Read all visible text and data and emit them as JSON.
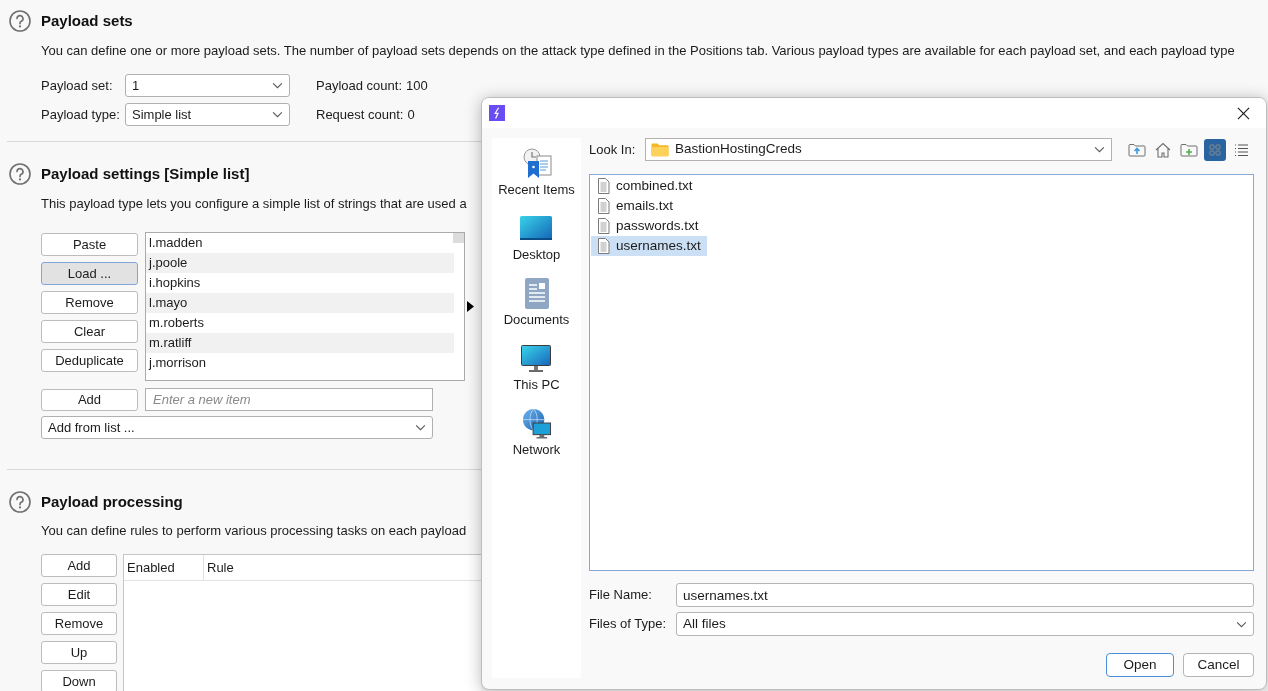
{
  "payload_sets": {
    "title": "Payload sets",
    "description": "You can define one or more payload sets. The number of payload sets depends on the attack type defined in the Positions tab. Various payload types are available for each payload set, and each payload type",
    "fields": [
      {
        "label": "Payload set:",
        "value": "1"
      },
      {
        "label": "Payload type:",
        "value": "Simple list"
      }
    ],
    "counts": [
      {
        "label": "Payload count:",
        "value": "100"
      },
      {
        "label": "Request count:",
        "value": "0"
      }
    ]
  },
  "payload_settings": {
    "title": "Payload settings [Simple list]",
    "description": "This payload type lets you configure a simple list of strings that are used a",
    "buttons": [
      {
        "label": "Paste",
        "focused": false
      },
      {
        "label": "Load ...",
        "focused": true
      },
      {
        "label": "Remove",
        "focused": false
      },
      {
        "label": "Clear",
        "focused": false
      },
      {
        "label": "Deduplicate",
        "focused": false
      }
    ],
    "items": [
      "l.madden",
      "j.poole",
      "i.hopkins",
      "l.mayo",
      "m.roberts",
      "m.ratliff",
      "j.morrison"
    ],
    "add_button": "Add",
    "new_item": {
      "placeholder": "Enter a new item"
    },
    "add_from_list": {
      "value": "Add from list ..."
    }
  },
  "payload_processing": {
    "title": "Payload processing",
    "description": "You can define rules to perform various processing tasks on each payload",
    "buttons": [
      "Add",
      "Edit",
      "Remove",
      "Up",
      "Down"
    ],
    "table": {
      "columns": [
        "Enabled",
        "Rule"
      ]
    }
  },
  "dialog": {
    "places": [
      {
        "label": "Recent Items",
        "kind": "recent"
      },
      {
        "label": "Desktop",
        "kind": "desktop"
      },
      {
        "label": "Documents",
        "kind": "documents"
      },
      {
        "label": "This PC",
        "kind": "computer"
      },
      {
        "label": "Network",
        "kind": "network"
      }
    ],
    "look_in": {
      "label": "Look In:",
      "value": "BastionHostingCreds"
    },
    "toolbar": [
      {
        "kind": "up",
        "selected": false
      },
      {
        "kind": "home",
        "selected": false
      },
      {
        "kind": "new_folder",
        "selected": false
      },
      {
        "kind": "icons",
        "selected": true
      },
      {
        "kind": "details",
        "selected": false
      }
    ],
    "files": [
      {
        "name": "combined.txt",
        "selected": false
      },
      {
        "name": "emails.txt",
        "selected": false
      },
      {
        "name": "passwords.txt",
        "selected": false
      },
      {
        "name": "usernames.txt",
        "selected": true
      }
    ],
    "file_name": {
      "label": "File Name:",
      "value": "usernames.txt"
    },
    "file_type": {
      "label": "Files of Type:",
      "value": "All files"
    },
    "buttons": [
      {
        "label": "Open",
        "default": true
      },
      {
        "label": "Cancel",
        "default": false
      }
    ]
  }
}
